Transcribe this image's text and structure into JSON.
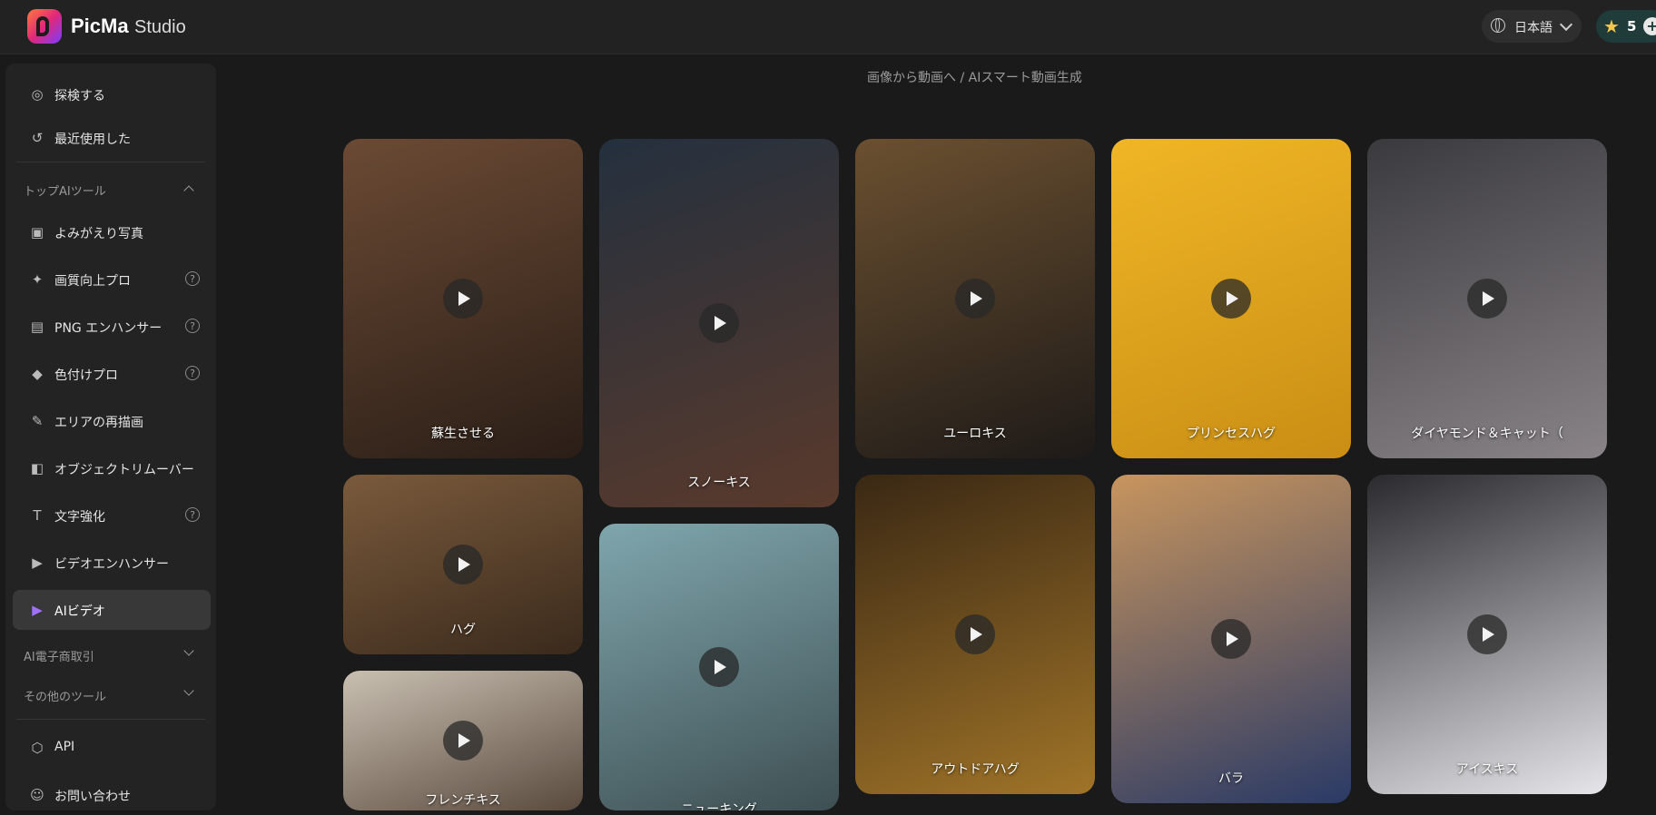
{
  "header": {
    "brand": "PicMa",
    "brand_sub": "Studio",
    "language": "日本語",
    "credits": "5"
  },
  "sidebar": {
    "explore": "探検する",
    "recent": "最近使用した",
    "top_tools_heading": "トップAIツール",
    "tools": [
      {
        "label": "よみがえり写真"
      },
      {
        "label": "画質向上プロ"
      },
      {
        "label": "PNG エンハンサー"
      },
      {
        "label": "色付けプロ"
      },
      {
        "label": "エリアの再描画"
      },
      {
        "label": "オブジェクトリムーバー"
      },
      {
        "label": "文字強化"
      },
      {
        "label": "ビデオエンハンサー"
      },
      {
        "label": "AIビデオ"
      }
    ],
    "ecommerce_heading": "AI電子商取引",
    "other_tools_heading": "その他のツール",
    "api": "API",
    "contact": "お問い合わせ"
  },
  "breadcrumb": "画像から動画へ / AIスマート動画生成",
  "cards": [
    {
      "title": "蘇生させる",
      "colors": [
        "#6b4a34",
        "#2a1e17"
      ]
    },
    {
      "title": "ハグ",
      "colors": [
        "#7a5a3c",
        "#3a2a1c"
      ]
    },
    {
      "title": "フレンチキス",
      "colors": [
        "#c9c0b2",
        "#5a4a3e"
      ]
    },
    {
      "title": "スノーキス",
      "colors": [
        "#24303e",
        "#5a3a2c"
      ]
    },
    {
      "title": "ニューキング",
      "colors": [
        "#7fa6ad",
        "#3e4f52"
      ]
    },
    {
      "title": "ユーロキス",
      "colors": [
        "#6b5030",
        "#1e1a18"
      ]
    },
    {
      "title": "アウトドアハグ",
      "colors": [
        "#3a2814",
        "#a07428"
      ]
    },
    {
      "title": "プリンセスハグ",
      "colors": [
        "#f0b626",
        "#c98e14"
      ]
    },
    {
      "title": "バラ",
      "colors": [
        "#c8955e",
        "#2a3a66"
      ]
    },
    {
      "title": "ダイヤモンド＆キャット（",
      "colors": [
        "#3a3a3e",
        "#8a8488"
      ]
    },
    {
      "title": "アイスキス",
      "colors": [
        "#2a2a2e",
        "#e6e6ea"
      ]
    }
  ]
}
